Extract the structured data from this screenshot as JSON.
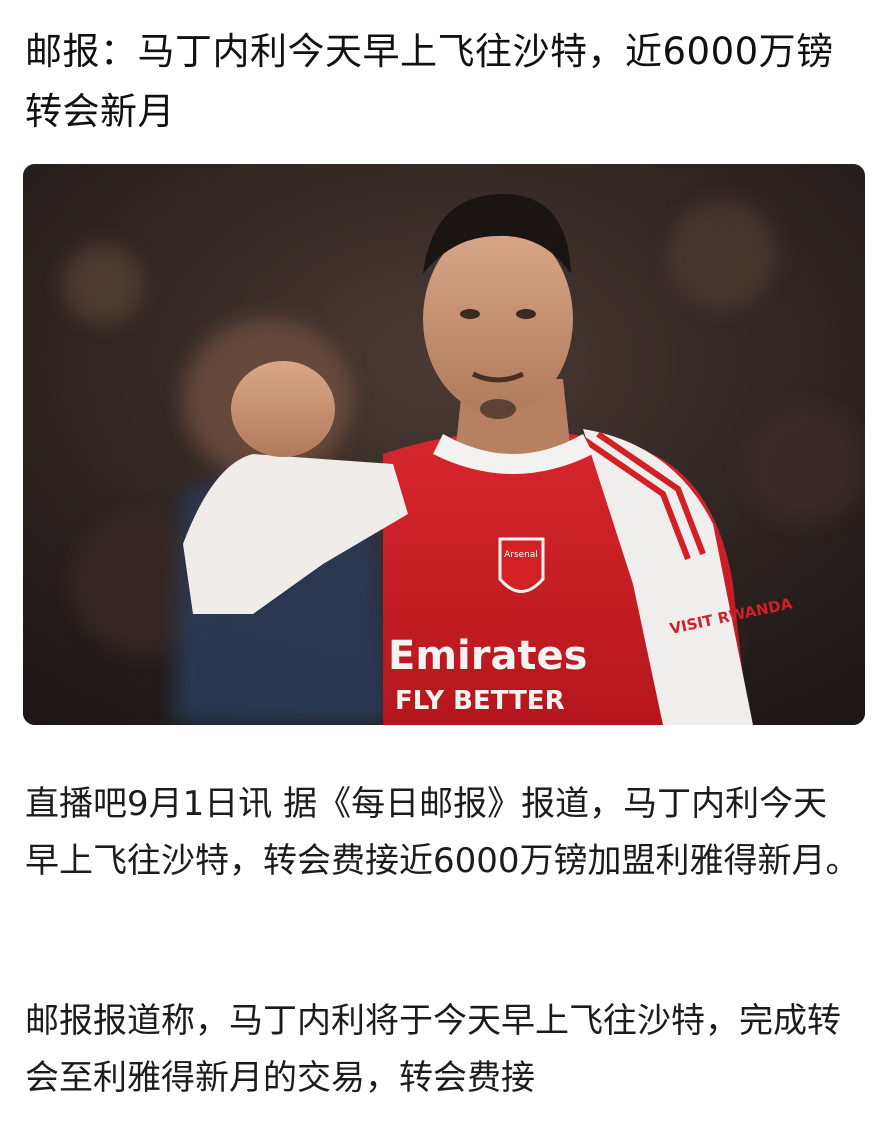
{
  "article": {
    "headline": "邮报：马丁内利今天早上飞往沙特，近6000万镑转会新月",
    "image": {
      "subject": "football-player-photo",
      "kit_text_sponsor_1": "Emirates",
      "kit_text_sponsor_2": "FLY BETTER",
      "kit_text_sleeve": "VISIT RWANDA",
      "kit_text_crest": "Arsenal",
      "colors": {
        "shirt_red": "#d31f26",
        "sleeve_white": "#f2f0ee",
        "background": "#2a2220"
      }
    },
    "paragraphs": [
      "直播吧9月1日讯 据《每日邮报》报道，马丁内利今天早上飞往沙特，转会费接近6000万镑加盟利雅得新月。",
      "邮报报道称，马丁内利将于今天早上飞往沙特，完成转会至利雅得新月的交易，转会费接"
    ]
  }
}
